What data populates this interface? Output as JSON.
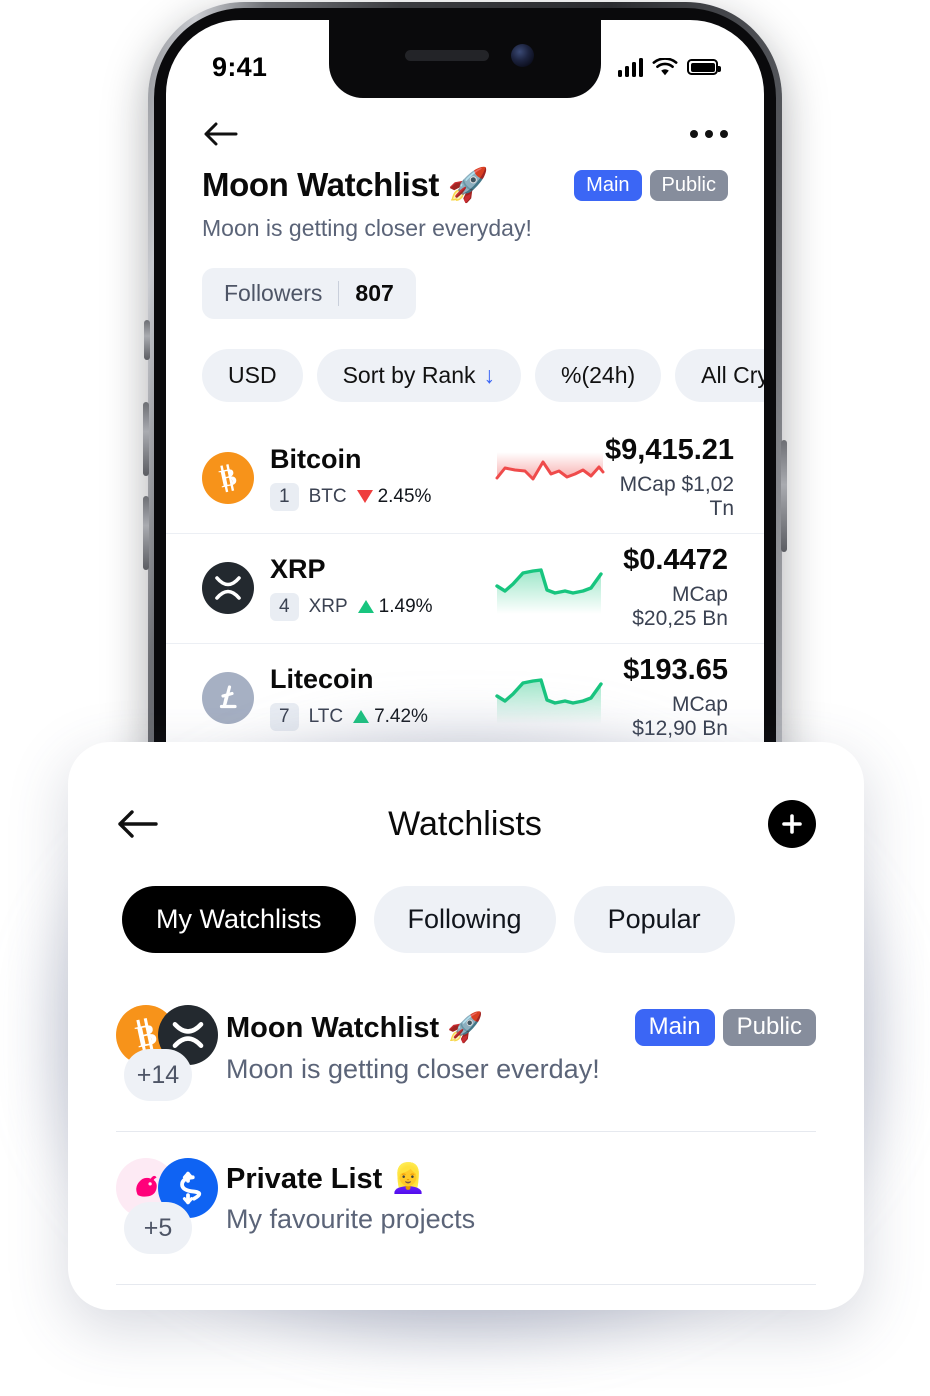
{
  "status_bar": {
    "time": "9:41",
    "signal_icon": "cellular-bars-icon",
    "wifi_icon": "wifi-icon",
    "battery_icon": "battery-full-icon"
  },
  "phone_screen": {
    "topbar": {
      "back_icon": "back-arrow-icon",
      "more_icon": "more-horizontal-icon"
    },
    "header": {
      "title": "Moon Watchlist 🚀",
      "badges": [
        {
          "label": "Main",
          "color": "#3b66f5"
        },
        {
          "label": "Public",
          "color": "#868d9c"
        }
      ],
      "subtitle": "Moon is getting closer everyday!",
      "followers_label": "Followers",
      "followers_count": "807"
    },
    "filters": [
      {
        "label": "USD",
        "icon": ""
      },
      {
        "label": "Sort by Rank",
        "icon": "arrow-down-icon"
      },
      {
        "label": "%(24h)",
        "icon": ""
      },
      {
        "label": "All Cry",
        "icon": ""
      }
    ],
    "coins": [
      {
        "name": "Bitcoin",
        "rank": "1",
        "symbol": "BTC",
        "change": "2.45%",
        "direction": "down",
        "price": "$9,415.21",
        "mcap": "MCap $1,02 Tn",
        "icon": "bitcoin-icon",
        "icon_color": "#f7931a",
        "glyph": "₿",
        "spark_color": "#ef4b4b"
      },
      {
        "name": "XRP",
        "rank": "4",
        "symbol": "XRP",
        "change": "1.49%",
        "direction": "up",
        "price": "$0.4472",
        "mcap": "MCap $20,25 Bn",
        "icon": "xrp-icon",
        "icon_color": "#23292f",
        "glyph": "✕",
        "spark_color": "#18c57f"
      },
      {
        "name": "Litecoin",
        "rank": "7",
        "symbol": "LTC",
        "change": "7.42%",
        "direction": "up",
        "price": "$193.65",
        "mcap": "MCap $12,90 Bn",
        "icon": "litecoin-icon",
        "icon_color": "#a6b0c3",
        "glyph": "Ł",
        "spark_color": "#18c57f"
      }
    ]
  },
  "bottom_sheet": {
    "back_icon": "back-arrow-icon",
    "title": "Watchlists",
    "add_icon": "plus-icon",
    "tabs": [
      {
        "label": "My Watchlists",
        "active": true
      },
      {
        "label": "Following",
        "active": false
      },
      {
        "label": "Popular",
        "active": false
      }
    ],
    "watchlists": [
      {
        "name": "Moon Watchlist 🚀",
        "description": "Moon is getting closer everday!",
        "more_count": "+14",
        "badges": [
          {
            "label": "Main",
            "color": "#3b66f5"
          },
          {
            "label": "Public",
            "color": "#868d9c"
          }
        ],
        "avatar_1": "bitcoin-icon",
        "avatar_2": "xrp-icon"
      },
      {
        "name": "Private List 👱‍♀️",
        "description": "My favourite projects",
        "more_count": "+5",
        "badges": [],
        "avatar_1": "uniswap-icon",
        "avatar_2": "synthetix-icon"
      }
    ]
  }
}
